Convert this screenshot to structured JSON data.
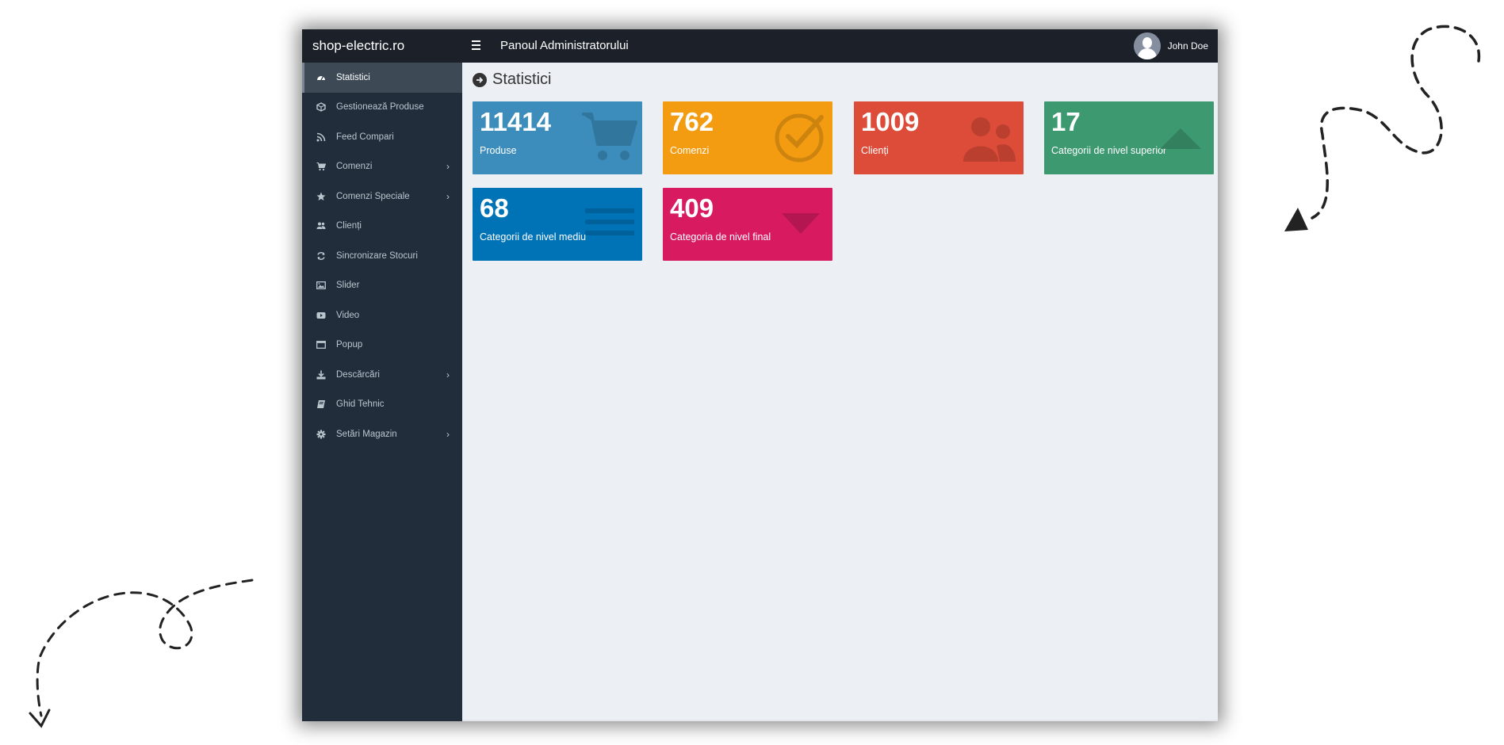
{
  "brand": "shop-electric.ro",
  "header": {
    "title": "Panoul Administratorului",
    "user_name": "John Doe"
  },
  "sidebar": {
    "items": [
      {
        "label": "Statistici",
        "icon": "dashboard-icon",
        "active": true
      },
      {
        "label": "Gestionează Produse",
        "icon": "cube-icon"
      },
      {
        "label": "Feed Compari",
        "icon": "rss-icon"
      },
      {
        "label": "Comenzi",
        "icon": "cart-icon",
        "submenu": true
      },
      {
        "label": "Comenzi Speciale",
        "icon": "star-icon",
        "submenu": true
      },
      {
        "label": "Clienți",
        "icon": "users-icon"
      },
      {
        "label": "Sincronizare Stocuri",
        "icon": "refresh-icon"
      },
      {
        "label": "Slider",
        "icon": "image-icon"
      },
      {
        "label": "Video",
        "icon": "video-icon"
      },
      {
        "label": "Popup",
        "icon": "window-icon"
      },
      {
        "label": "Descărcări",
        "icon": "download-icon",
        "submenu": true
      },
      {
        "label": "Ghid Tehnic",
        "icon": "book-icon"
      },
      {
        "label": "Setări Magazin",
        "icon": "gear-icon",
        "submenu": true
      }
    ]
  },
  "main": {
    "title": "Statistici",
    "stats": [
      {
        "value": "11414",
        "label": "Produse",
        "color": "#3c8dbc",
        "icon": "cart-icon"
      },
      {
        "value": "762",
        "label": "Comenzi",
        "color": "#f39c12",
        "icon": "check-circle-icon"
      },
      {
        "value": "1009",
        "label": "Clienți",
        "color": "#dd4b39",
        "icon": "users-icon"
      },
      {
        "value": "17",
        "label": "Categorii de nivel superior",
        "color": "#3d9970",
        "icon": "triangle-up-icon"
      },
      {
        "value": "68",
        "label": "Categorii de nivel mediu",
        "color": "#0073b7",
        "icon": "bars-icon"
      },
      {
        "value": "409",
        "label": "Categoria de nivel final",
        "color": "#d81b60",
        "icon": "triangle-down-icon"
      }
    ]
  }
}
